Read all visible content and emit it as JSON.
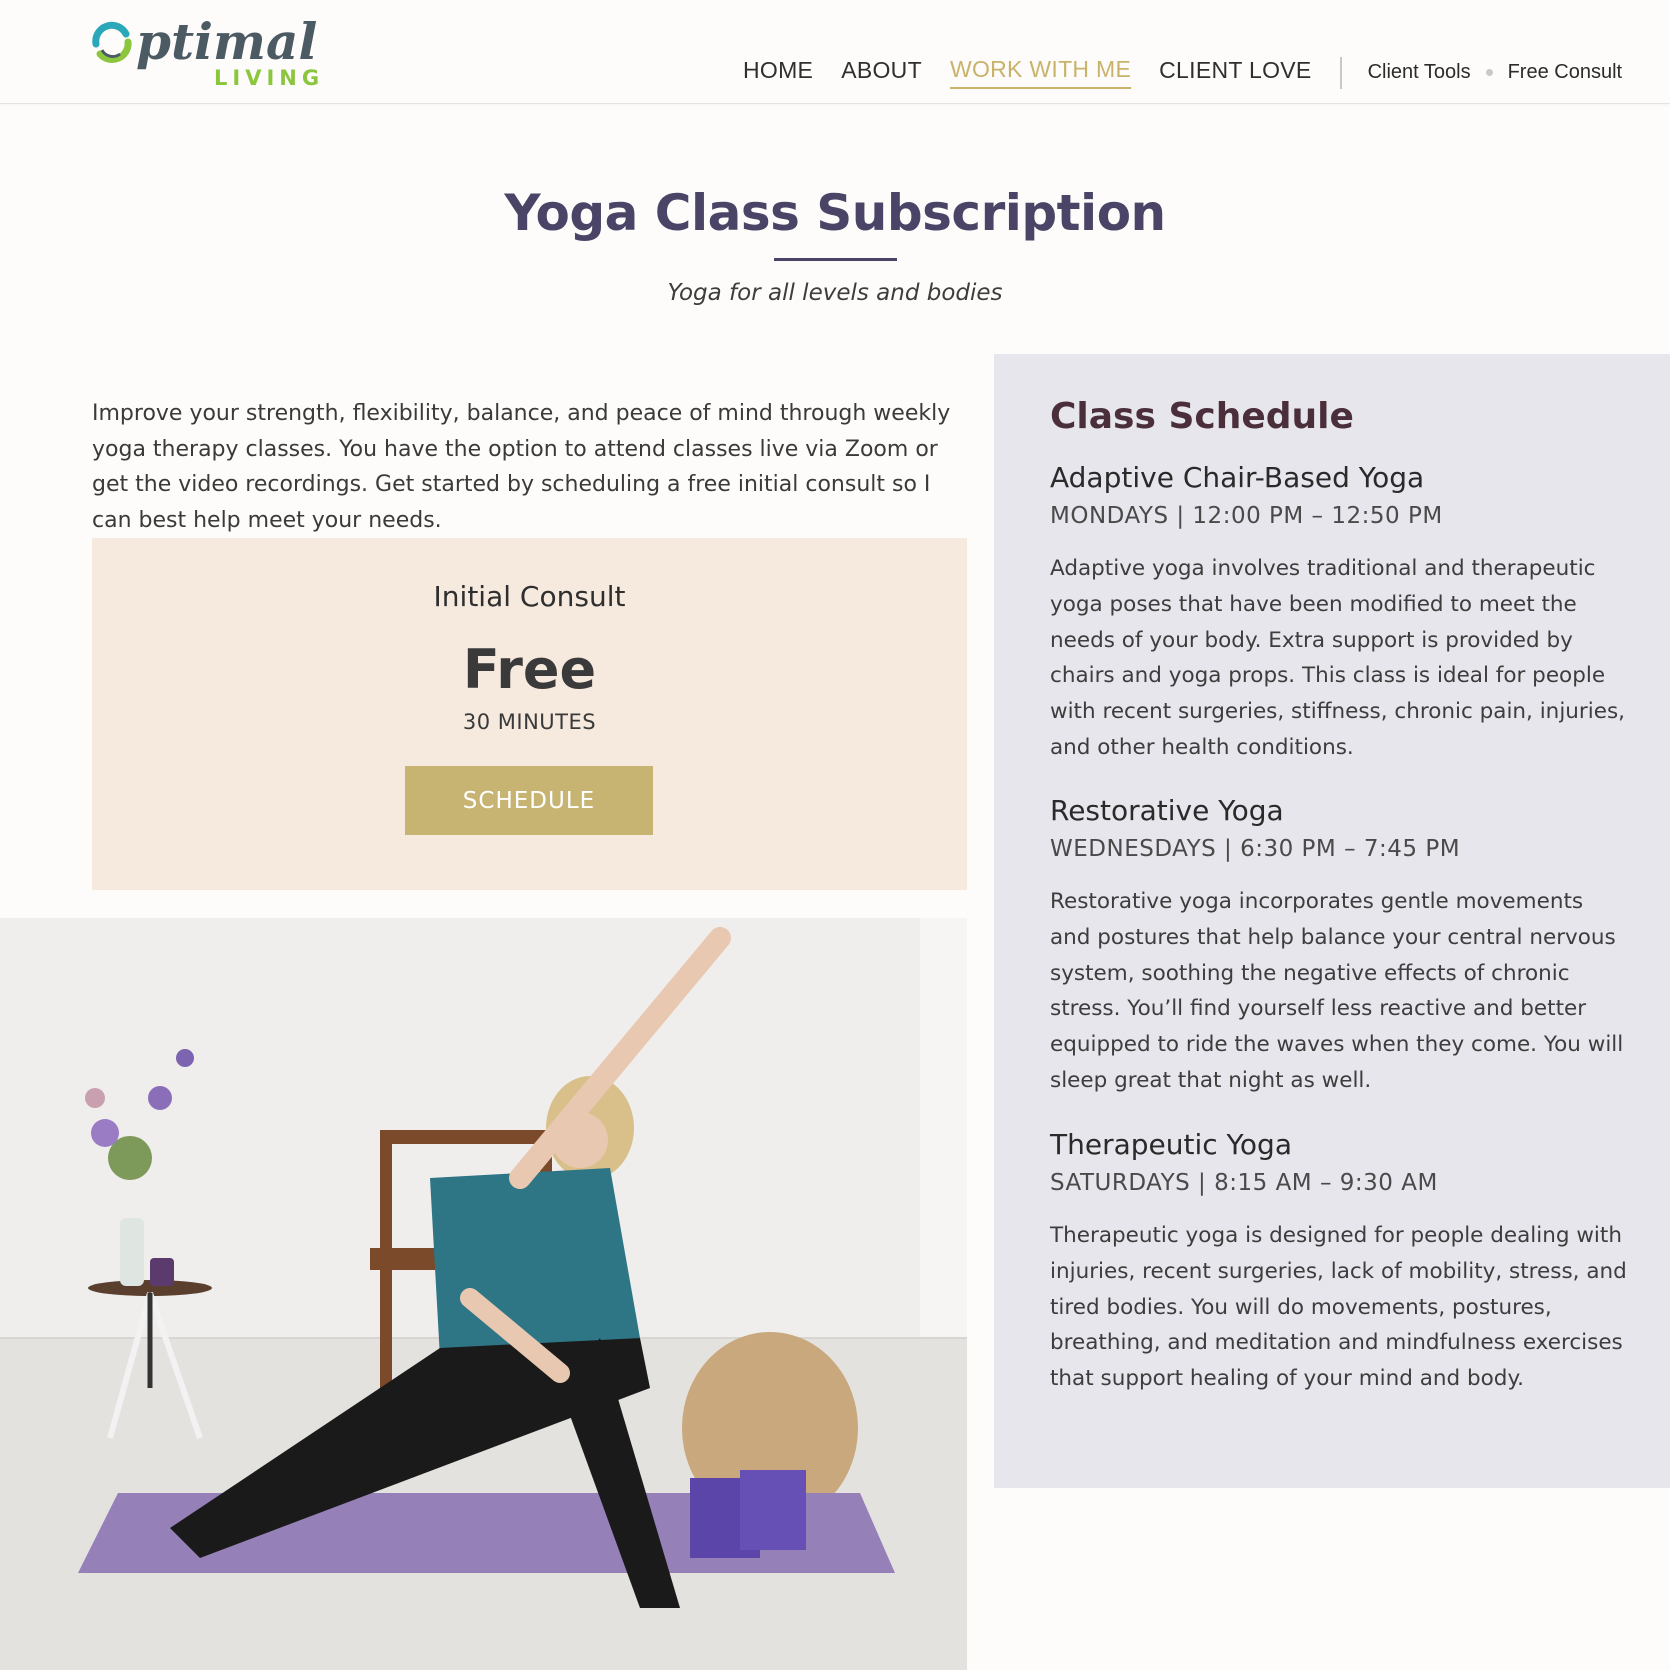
{
  "logo": {
    "word": "ptimal",
    "sub": "LIVING"
  },
  "nav": {
    "items": [
      "HOME",
      "ABOUT",
      "WORK WITH ME",
      "CLIENT LOVE"
    ],
    "client_tools": "Client Tools",
    "free_consult": "Free Consult"
  },
  "colors": {
    "accent_gold": "#c9b26a",
    "title_purple": "#4a4566",
    "consult_bg": "#f6e9de",
    "schedule_bg": "#e6e6ec",
    "logo_green": "#8cc63f"
  },
  "page": {
    "title": "Yoga Class Subscription",
    "subtitle": "Yoga for all levels and bodies",
    "intro": "Improve your strength, flexibility, balance, and peace of mind through weekly yoga therapy classes. You have the option to attend classes live via Zoom or get the video recordings. Get started by scheduling a free initial consult so I can best help meet your needs."
  },
  "consult": {
    "title": "Initial Consult",
    "price": "Free",
    "duration": "30 MINUTES",
    "button": "SCHEDULE"
  },
  "schedule": {
    "title": "Class Schedule",
    "classes": [
      {
        "name": "Adaptive Chair-Based Yoga",
        "time": "MONDAYS | 12:00 PM – 12:50 PM",
        "desc": "Adaptive yoga involves traditional and therapeutic yoga poses that have been modified to meet the needs of your body. Extra support is provided by chairs and yoga props. This class is ideal for people with recent surgeries, stiffness, chronic pain, injuries, and other health conditions."
      },
      {
        "name": "Restorative Yoga",
        "time": "WEDNESDAYS | 6:30 PM – 7:45 PM",
        "desc": "Restorative yoga incorporates gentle movements and postures that help balance your central nervous system, soothing the negative effects of chronic stress. You’ll find yourself less reactive and better equipped to ride the waves when they come. You will sleep great that night as well."
      },
      {
        "name": "Therapeutic Yoga",
        "time": "SATURDAYS | 8:15 AM – 9:30 AM",
        "desc": "Therapeutic yoga is designed for people dealing with injuries, recent surgeries, lack of mobility, stress, and tired bodies. You will do movements, postures, breathing, and meditation and mindfulness exercises that support healing of your mind and body."
      }
    ]
  }
}
